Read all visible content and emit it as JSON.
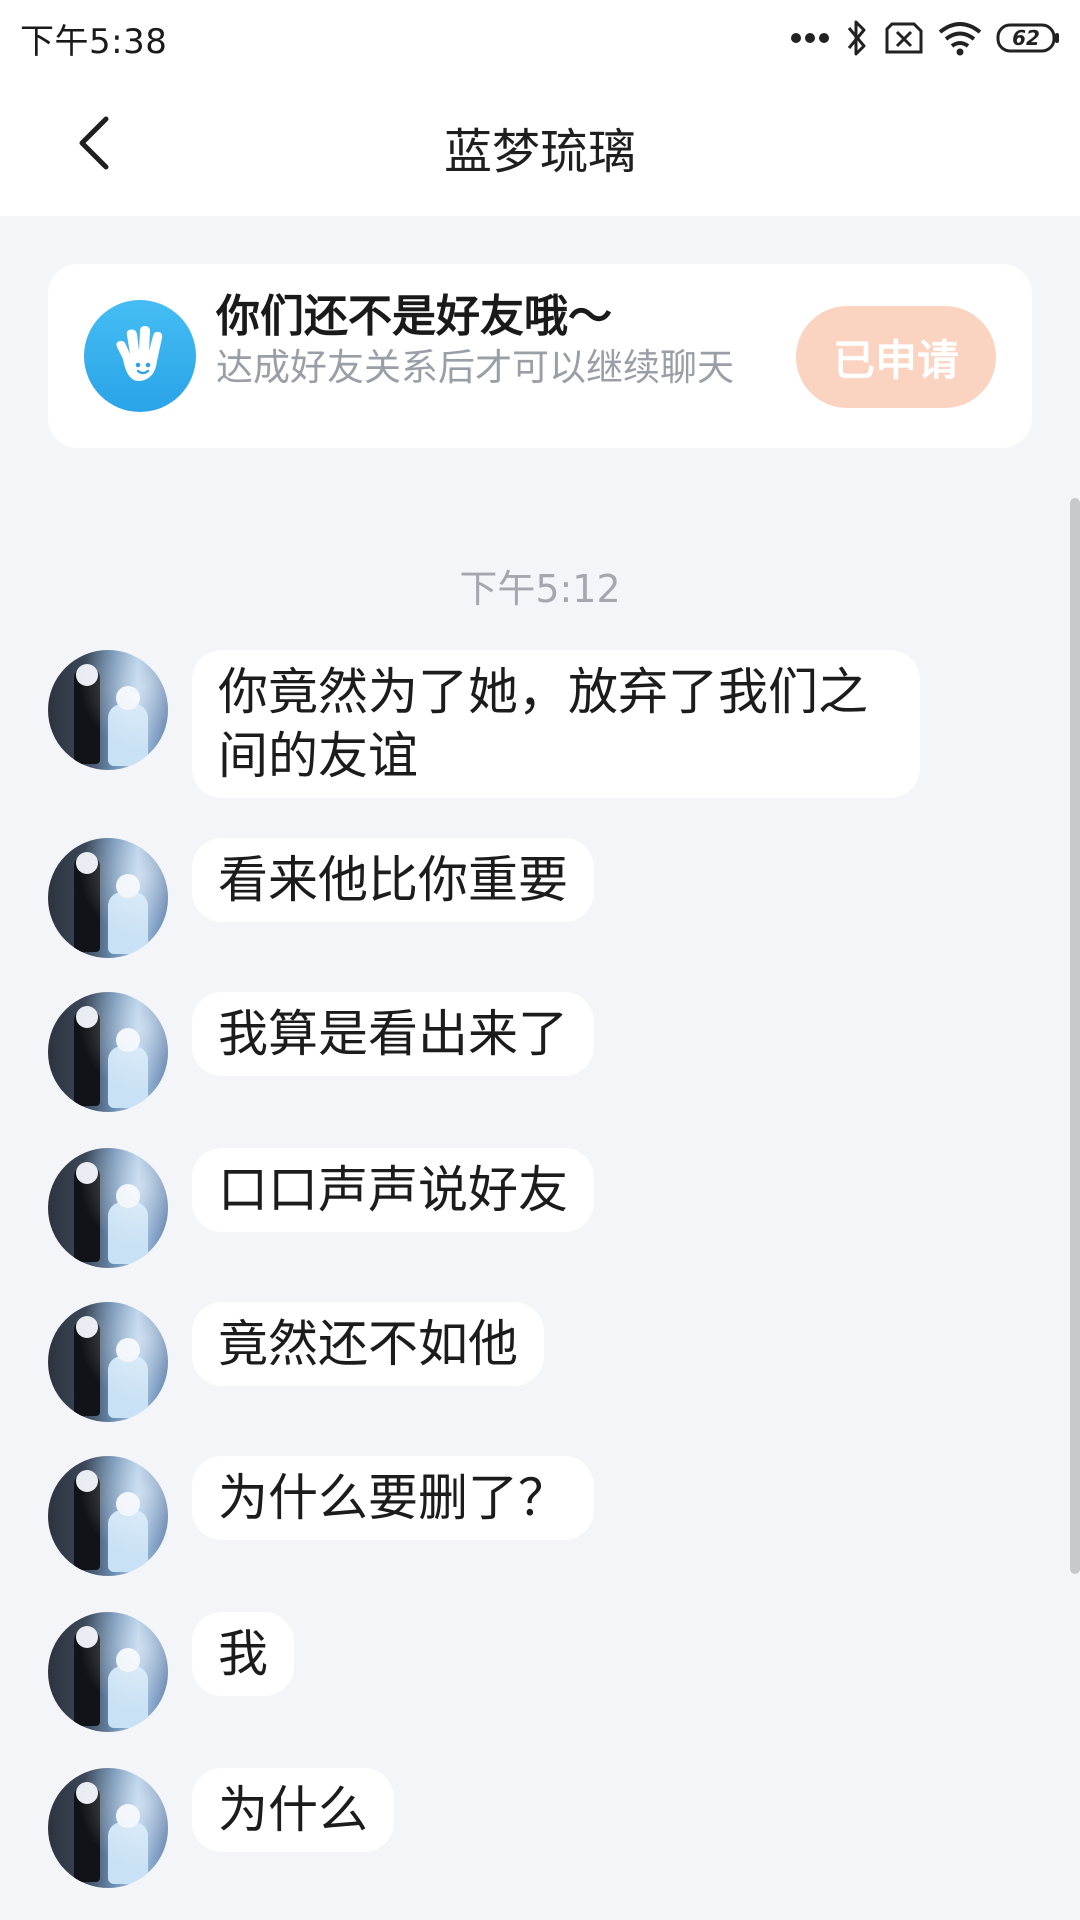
{
  "status_bar": {
    "time": "下午5:38",
    "battery": "62",
    "icons": [
      "more-dots-icon",
      "bluetooth-icon",
      "no-sim-icon",
      "wifi-icon",
      "battery-icon"
    ]
  },
  "header": {
    "title": "蓝梦琉璃",
    "back_icon": "chevron-left-icon"
  },
  "friend_notice": {
    "icon": "waving-hand-icon",
    "title": "你们还不是好友哦～",
    "subtitle": "达成好友关系后才可以继续聊天",
    "button_label": "已申请",
    "button_color": "#fbd3c1",
    "icon_color": "#2aa3e8"
  },
  "chat": {
    "timestamp": "下午5:12",
    "messages": [
      {
        "text": "你竟然为了她，放弃了我们之间的友谊"
      },
      {
        "text": "看来他比你重要"
      },
      {
        "text": "我算是看出来了"
      },
      {
        "text": "口口声声说好友"
      },
      {
        "text": "竟然还不如他"
      },
      {
        "text": "为什么要删了？"
      },
      {
        "text": "我"
      },
      {
        "text": "为什么"
      }
    ]
  }
}
